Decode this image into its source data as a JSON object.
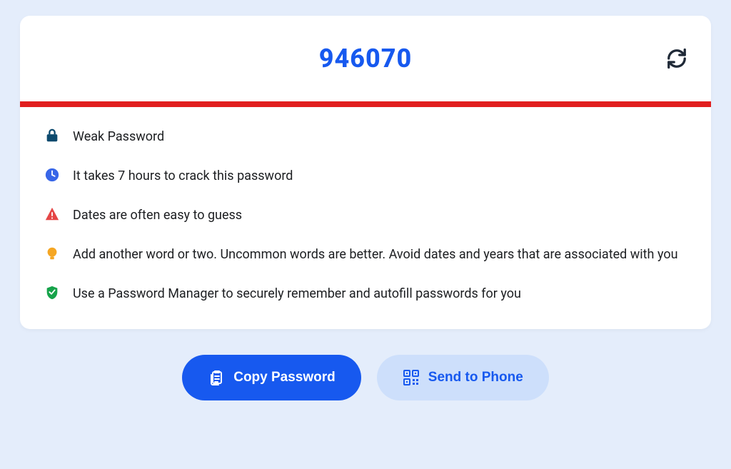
{
  "password": "946070",
  "strength_color": "#e11e1e",
  "feedback": [
    {
      "icon": "lock",
      "text": "Weak Password"
    },
    {
      "icon": "clock",
      "text": "It takes 7 hours to crack this password"
    },
    {
      "icon": "warn",
      "text": "Dates are often easy to guess"
    },
    {
      "icon": "bulb",
      "text": "Add another word or two. Uncommon words are better. Avoid dates and years that are associated with you"
    },
    {
      "icon": "shield",
      "text": "Use a Password Manager to securely remember and autofill passwords for you"
    }
  ],
  "actions": {
    "copy_label": "Copy Password",
    "send_label": "Send to Phone"
  }
}
